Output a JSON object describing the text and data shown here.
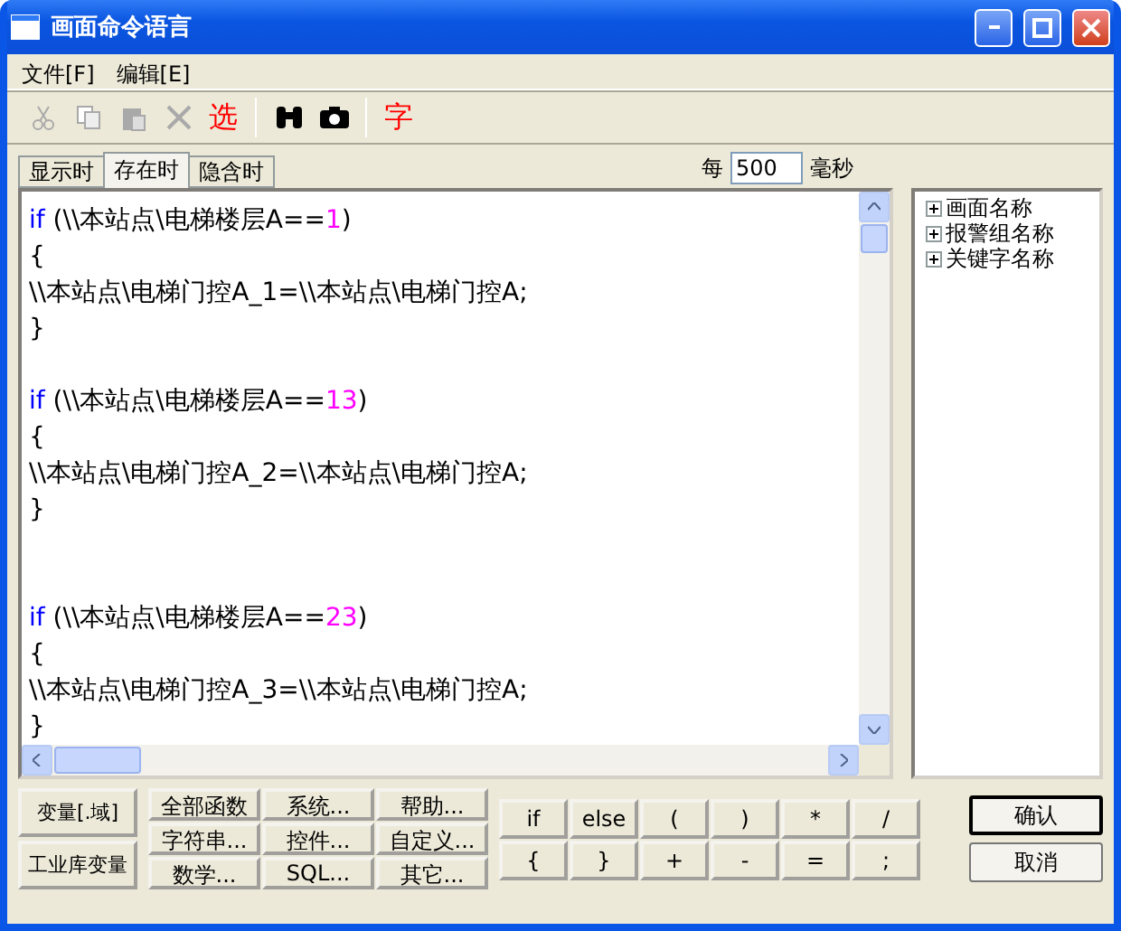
{
  "window": {
    "title": "画面命令语言"
  },
  "menu": [
    "文件[F]",
    "编辑[E]"
  ],
  "toolbar": [
    {
      "kind": "cut",
      "disabled": true
    },
    {
      "kind": "copy",
      "disabled": true
    },
    {
      "kind": "paste",
      "disabled": true
    },
    {
      "kind": "delete",
      "disabled": true
    },
    {
      "kind": "glyph",
      "text": "选"
    },
    {
      "kind": "separator"
    },
    {
      "kind": "find"
    },
    {
      "kind": "camera"
    },
    {
      "kind": "separator"
    },
    {
      "kind": "glyph",
      "text": "字"
    }
  ],
  "tabs": [
    {
      "label": "显示时",
      "selected": false
    },
    {
      "label": "存在时",
      "selected": true
    },
    {
      "label": "隐含时",
      "selected": false
    }
  ],
  "interval": {
    "prefix": "每",
    "value": "500",
    "suffix": "毫秒"
  },
  "code": [
    {
      "kind": "text",
      "segments": [
        {
          "kind": "keyword",
          "text": "if"
        },
        {
          "kind": "plain",
          "text": " (\\\\本站点\\电梯楼层A=="
        },
        {
          "kind": "number",
          "text": "1"
        },
        {
          "kind": "plain",
          "text": ")"
        }
      ]
    },
    {
      "kind": "text",
      "segments": [
        {
          "kind": "plain",
          "text": "{"
        }
      ]
    },
    {
      "kind": "text",
      "segments": [
        {
          "kind": "plain",
          "text": "\\\\本站点\\电梯门控A_1=\\\\本站点\\电梯门控A;"
        }
      ]
    },
    {
      "kind": "text",
      "segments": [
        {
          "kind": "plain",
          "text": "}"
        }
      ]
    },
    {
      "kind": "blank"
    },
    {
      "kind": "text",
      "segments": [
        {
          "kind": "keyword",
          "text": "if"
        },
        {
          "kind": "plain",
          "text": " (\\\\本站点\\电梯楼层A=="
        },
        {
          "kind": "number",
          "text": "13"
        },
        {
          "kind": "plain",
          "text": ")"
        }
      ]
    },
    {
      "kind": "text",
      "segments": [
        {
          "kind": "plain",
          "text": "{"
        }
      ]
    },
    {
      "kind": "text",
      "segments": [
        {
          "kind": "plain",
          "text": "\\\\本站点\\电梯门控A_2=\\\\本站点\\电梯门控A;"
        }
      ]
    },
    {
      "kind": "text",
      "segments": [
        {
          "kind": "plain",
          "text": "}"
        }
      ]
    },
    {
      "kind": "blank"
    },
    {
      "kind": "blank"
    },
    {
      "kind": "text",
      "segments": [
        {
          "kind": "keyword",
          "text": "if"
        },
        {
          "kind": "plain",
          "text": " (\\\\本站点\\电梯楼层A=="
        },
        {
          "kind": "number",
          "text": "23"
        },
        {
          "kind": "plain",
          "text": ")"
        }
      ]
    },
    {
      "kind": "text",
      "segments": [
        {
          "kind": "plain",
          "text": "{"
        }
      ]
    },
    {
      "kind": "text",
      "segments": [
        {
          "kind": "plain",
          "text": "\\\\本站点\\电梯门控A_3=\\\\本站点\\电梯门控A;"
        }
      ]
    },
    {
      "kind": "text",
      "segments": [
        {
          "kind": "plain",
          "text": "}"
        }
      ]
    }
  ],
  "tree": [
    {
      "label": "画面名称",
      "expanded": false
    },
    {
      "label": "报警组名称",
      "expanded": false
    },
    {
      "label": "关键字名称",
      "expanded": false
    }
  ],
  "variable_buttons": [
    "变量[.域]",
    "工业库变量"
  ],
  "function_buttons": [
    "全部函数",
    "系统...",
    "帮助...",
    "字符串...",
    "控件...",
    "自定义...",
    "数学...",
    "SQL...",
    "其它..."
  ],
  "operator_buttons": [
    "if",
    "else",
    "(",
    ")",
    "*",
    "/",
    "{",
    "}",
    "+",
    "-",
    "=",
    ";"
  ],
  "dialog_buttons": [
    {
      "label": "确认",
      "default": true
    },
    {
      "label": "取消",
      "default": false
    }
  ]
}
